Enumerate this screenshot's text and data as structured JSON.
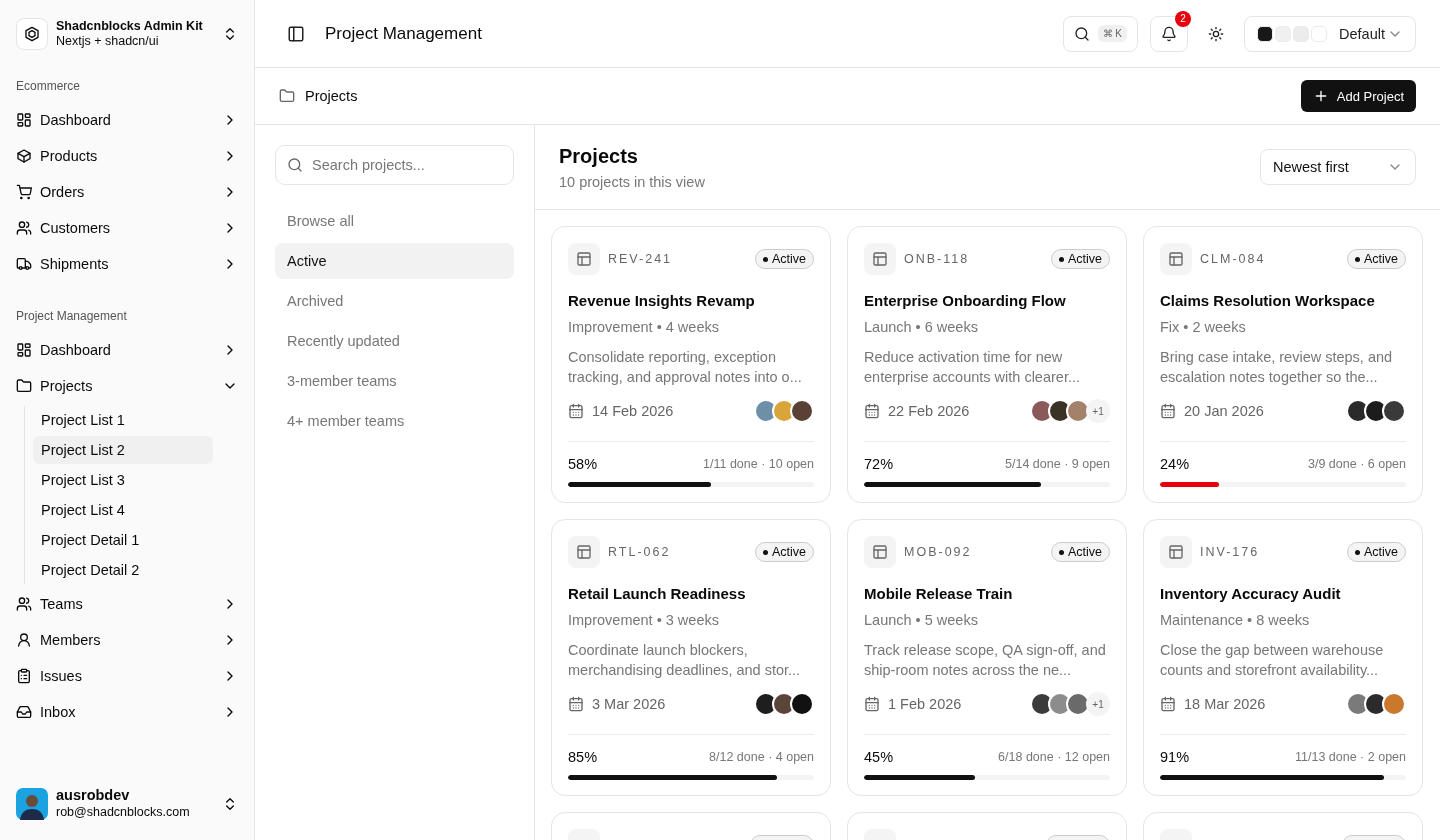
{
  "sidebar": {
    "brand": {
      "name": "Shadcnblocks Admin Kit",
      "subtitle": "Nextjs + shadcn/ui"
    },
    "groups": [
      {
        "label": "Ecommerce",
        "items": [
          {
            "label": "Dashboard",
            "expanded": false
          },
          {
            "label": "Products",
            "expanded": false
          },
          {
            "label": "Orders",
            "expanded": false
          },
          {
            "label": "Customers",
            "expanded": false
          },
          {
            "label": "Shipments",
            "expanded": false
          }
        ]
      },
      {
        "label": "Project Management",
        "items": [
          {
            "label": "Dashboard",
            "expanded": false
          },
          {
            "label": "Projects",
            "expanded": true,
            "children": [
              {
                "label": "Project List 1",
                "selected": false
              },
              {
                "label": "Project List 2",
                "selected": true
              },
              {
                "label": "Project List 3",
                "selected": false
              },
              {
                "label": "Project List 4",
                "selected": false
              },
              {
                "label": "Project Detail 1",
                "selected": false
              },
              {
                "label": "Project Detail 2",
                "selected": false
              }
            ]
          },
          {
            "label": "Teams",
            "expanded": false
          },
          {
            "label": "Members",
            "expanded": false
          },
          {
            "label": "Issues",
            "expanded": false
          },
          {
            "label": "Inbox",
            "expanded": false
          }
        ]
      }
    ],
    "user": {
      "name": "ausrobdev",
      "email": "rob@shadcnblocks.com"
    }
  },
  "header": {
    "title": "Project Management",
    "search_shortcut": "⌘ K",
    "notifications": "2",
    "theme": {
      "label": "Default",
      "swatches": [
        {
          "color": "#18181b"
        },
        {
          "color": "#f0f0f0"
        },
        {
          "color": "#ececec"
        },
        {
          "color": "#ffffff"
        }
      ]
    }
  },
  "breadcrumb": "Projects",
  "add_button": "Add Project",
  "filters": {
    "placeholder": "Search projects...",
    "items": [
      {
        "label": "Browse all",
        "selected": false
      },
      {
        "label": "Active",
        "selected": true
      },
      {
        "label": "Archived",
        "selected": false
      },
      {
        "label": "Recently updated",
        "selected": false
      },
      {
        "label": "3-member teams",
        "selected": false
      },
      {
        "label": "4+ member teams",
        "selected": false
      }
    ]
  },
  "list": {
    "title": "Projects",
    "subtitle": "10 projects in this view",
    "sort": "Newest first"
  },
  "projects": [
    {
      "kind": "card",
      "code": "REV-241",
      "status": "Active",
      "title": "Revenue Insights Revamp",
      "meta": "Improvement • 4 weeks",
      "description": "Consolidate reporting, exception tracking, and approval notes into o...",
      "date": "14 Feb 2026",
      "avatars": [
        {
          "color": "#6d8fa8"
        },
        {
          "color": "#d9a43a"
        },
        {
          "color": "#5a4136"
        }
      ],
      "percent": "58%",
      "stats": "1/11 done · 10 open",
      "level": 0.58,
      "color": "#111111"
    },
    {
      "kind": "card",
      "code": "ONB-118",
      "status": "Active",
      "title": "Enterprise Onboarding Flow",
      "meta": "Launch • 6 weeks",
      "description": "Reduce activation time for new enterprise accounts with clearer...",
      "date": "22 Feb 2026",
      "avatars": [
        {
          "color": "#8a5a5a"
        },
        {
          "color": "#3b3226"
        },
        {
          "color": "#a4826a"
        }
      ],
      "extra": "+1",
      "percent": "72%",
      "stats": "5/14 done · 9 open",
      "level": 0.72,
      "color": "#111111"
    },
    {
      "kind": "card",
      "code": "CLM-084",
      "status": "Active",
      "title": "Claims Resolution Workspace",
      "meta": "Fix • 2 weeks",
      "description": "Bring case intake, review steps, and escalation notes together so the...",
      "date": "20 Jan 2026",
      "avatars": [
        {
          "color": "#2a2a2a"
        },
        {
          "color": "#1c1c1c"
        },
        {
          "color": "#3a3a3a"
        }
      ],
      "percent": "24%",
      "stats": "3/9 done · 6 open",
      "level": 0.24,
      "color": "#e7000b"
    },
    {
      "kind": "card",
      "code": "RTL-062",
      "status": "Active",
      "title": "Retail Launch Readiness",
      "meta": "Improvement • 3 weeks",
      "description": "Coordinate launch blockers, merchandising deadlines, and stor...",
      "date": "3 Mar 2026",
      "avatars": [
        {
          "color": "#1e1e1e"
        },
        {
          "color": "#5b4438"
        },
        {
          "color": "#111111"
        }
      ],
      "percent": "85%",
      "stats": "8/12 done · 4 open",
      "level": 0.85,
      "color": "#111111"
    },
    {
      "kind": "card",
      "code": "MOB-092",
      "status": "Active",
      "title": "Mobile Release Train",
      "meta": "Launch • 5 weeks",
      "description": "Track release scope, QA sign-off, and ship-room notes across the ne...",
      "date": "1 Feb 2026",
      "avatars": [
        {
          "color": "#3c3c3c"
        },
        {
          "color": "#8c8c8c"
        },
        {
          "color": "#6a6a6a"
        }
      ],
      "extra": "+1",
      "percent": "45%",
      "stats": "6/18 done · 12 open",
      "level": 0.45,
      "color": "#111111"
    },
    {
      "kind": "card",
      "code": "INV-176",
      "status": "Active",
      "title": "Inventory Accuracy Audit",
      "meta": "Maintenance • 8 weeks",
      "description": "Close the gap between warehouse counts and storefront availability...",
      "date": "18 Mar 2026",
      "avatars": [
        {
          "color": "#7a7a7a"
        },
        {
          "color": "#2b2b2b"
        },
        {
          "color": "#c9782c"
        }
      ],
      "percent": "91%",
      "stats": "11/13 done · 2 open",
      "level": 0.91,
      "color": "#111111"
    },
    {
      "kind": "cut"
    },
    {
      "kind": "cut"
    },
    {
      "kind": "cut"
    }
  ]
}
